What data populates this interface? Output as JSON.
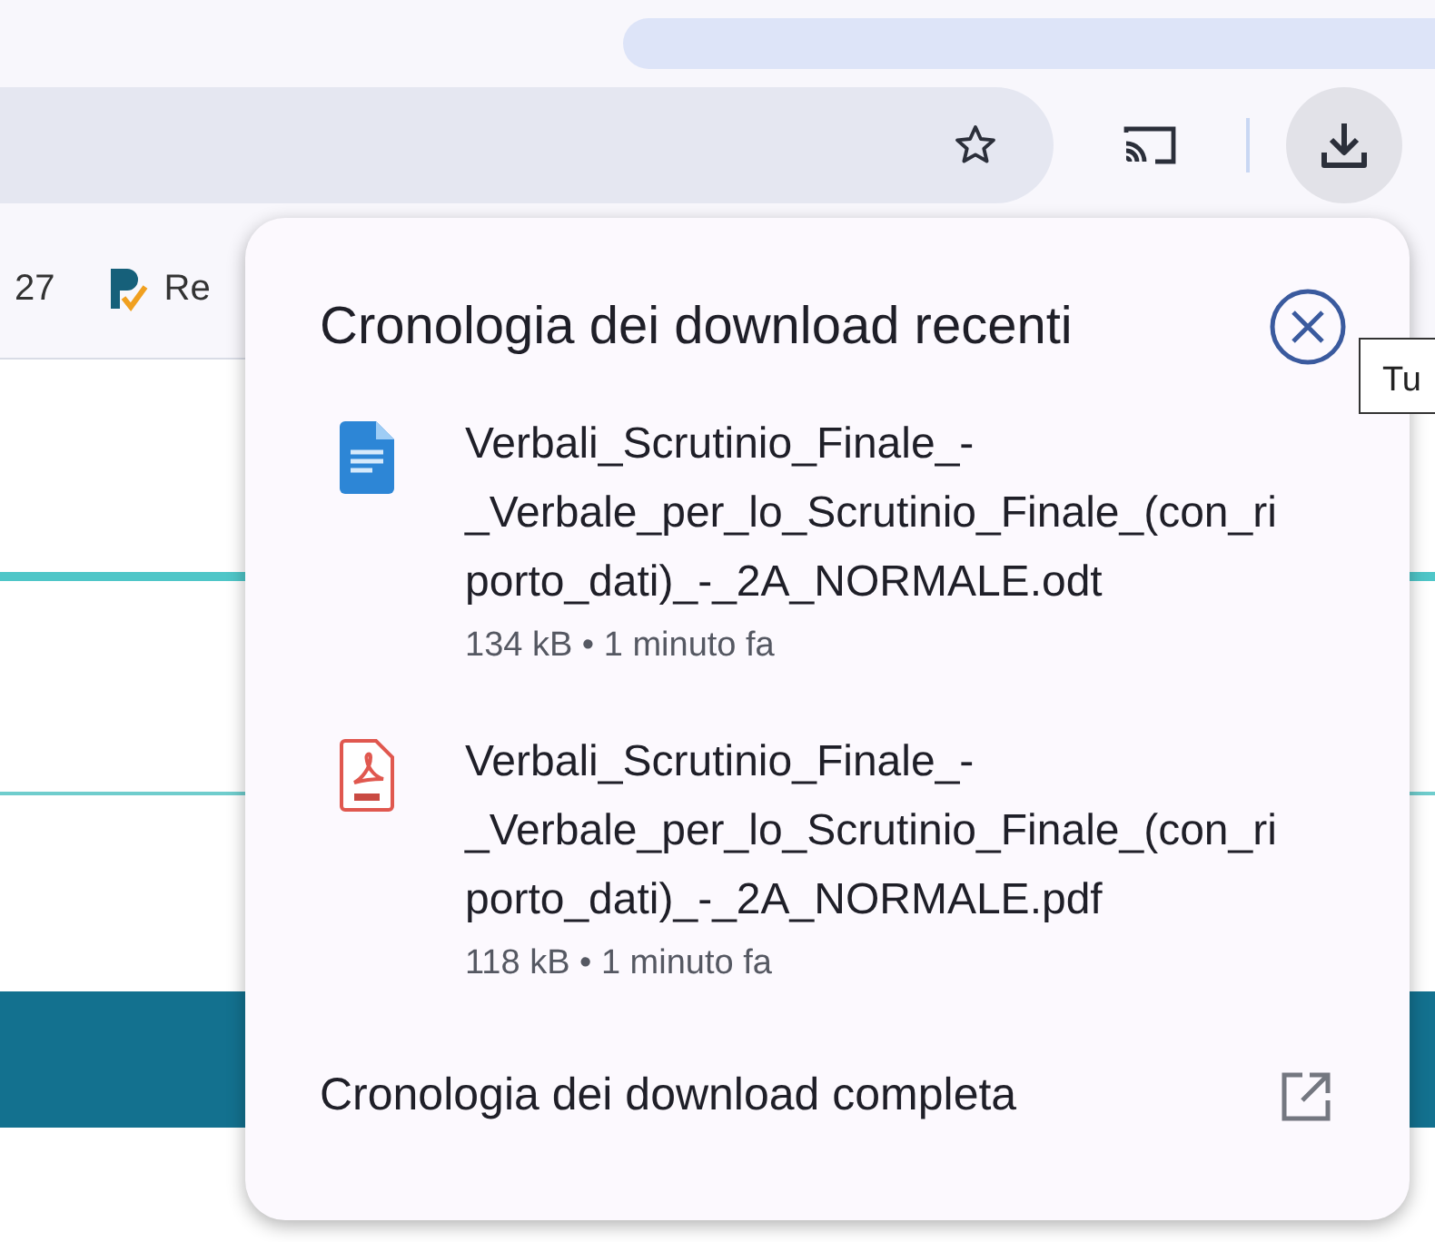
{
  "bookmarks_bar": {
    "items": [
      {
        "label": "27"
      },
      {
        "label": "Re"
      }
    ]
  },
  "tooltip": {
    "text": "Tu"
  },
  "downloads_popup": {
    "title": "Cronologia dei download recenti",
    "items": [
      {
        "kind": "odt",
        "filename": "Verbali_Scrutinio_Finale_-_Verbale_per_lo_Scrutinio_Finale_(con_riporto_dati)_-_2A_NORMALE.odt",
        "meta": "134 kB • 1 minuto fa"
      },
      {
        "kind": "pdf",
        "filename": "Verbali_Scrutinio_Finale_-_Verbale_per_lo_Scrutinio_Finale_(con_riporto_dati)_-_2A_NORMALE.pdf",
        "meta": "118 kB • 1 minuto fa"
      }
    ],
    "footer_link": "Cronologia dei download completa"
  }
}
